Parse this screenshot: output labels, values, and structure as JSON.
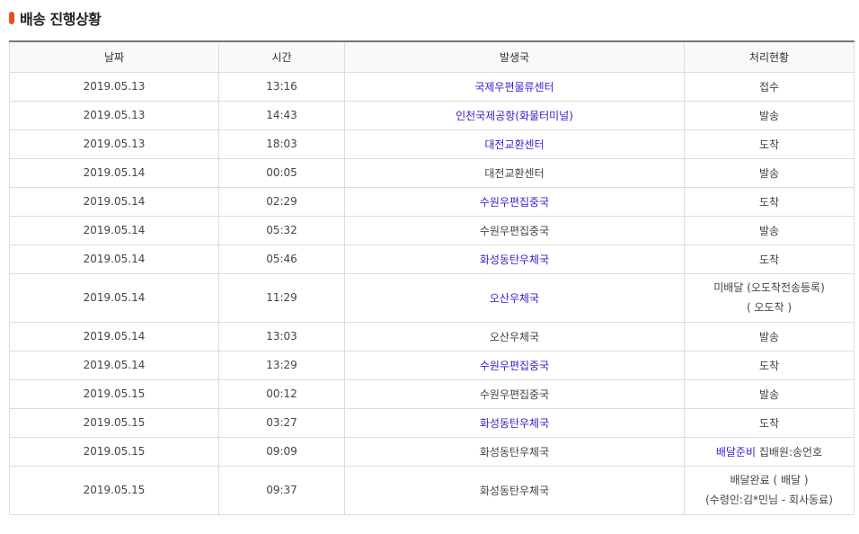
{
  "title": "배송 진행상황",
  "colors": {
    "accent": "#e8501a",
    "link": "#3b1ccf"
  },
  "headers": {
    "date": "날짜",
    "time": "시간",
    "office": "발생국",
    "status": "처리현황"
  },
  "rows": [
    {
      "date": "2019.05.13",
      "time": "13:16",
      "office": "국제우편물류센터",
      "office_link": true,
      "status": "접수"
    },
    {
      "date": "2019.05.13",
      "time": "14:43",
      "office": "인천국제공항(화물터미널)",
      "office_link": true,
      "status": "발송"
    },
    {
      "date": "2019.05.13",
      "time": "18:03",
      "office": "대전교환센터",
      "office_link": true,
      "status": "도착"
    },
    {
      "date": "2019.05.14",
      "time": "00:05",
      "office": "대전교환센터",
      "office_link": false,
      "status": "발송"
    },
    {
      "date": "2019.05.14",
      "time": "02:29",
      "office": "수원우편집중국",
      "office_link": true,
      "status": "도착"
    },
    {
      "date": "2019.05.14",
      "time": "05:32",
      "office": "수원우편집중국",
      "office_link": false,
      "status": "발송"
    },
    {
      "date": "2019.05.14",
      "time": "05:46",
      "office": "화성동탄우체국",
      "office_link": true,
      "status": "도착"
    },
    {
      "date": "2019.05.14",
      "time": "11:29",
      "office": "오산우체국",
      "office_link": true,
      "status": "미배달 (오도착전송등록)",
      "status_line2": "( 오도착 )"
    },
    {
      "date": "2019.05.14",
      "time": "13:03",
      "office": "오산우체국",
      "office_link": false,
      "status": "발송"
    },
    {
      "date": "2019.05.14",
      "time": "13:29",
      "office": "수원우편집중국",
      "office_link": true,
      "status": "도착"
    },
    {
      "date": "2019.05.15",
      "time": "00:12",
      "office": "수원우편집중국",
      "office_link": false,
      "status": "발송"
    },
    {
      "date": "2019.05.15",
      "time": "03:27",
      "office": "화성동탄우체국",
      "office_link": true,
      "status": "도착"
    },
    {
      "date": "2019.05.15",
      "time": "09:09",
      "office": "화성동탄우체국",
      "office_link": false,
      "status_link": "배달준비",
      "status": "집배원:송언호"
    },
    {
      "date": "2019.05.15",
      "time": "09:37",
      "office": "화성동탄우체국",
      "office_link": false,
      "status": "배달완료 ( 배달 )",
      "status_line2": "(수령인:김*민님 - 회사동료)"
    }
  ]
}
